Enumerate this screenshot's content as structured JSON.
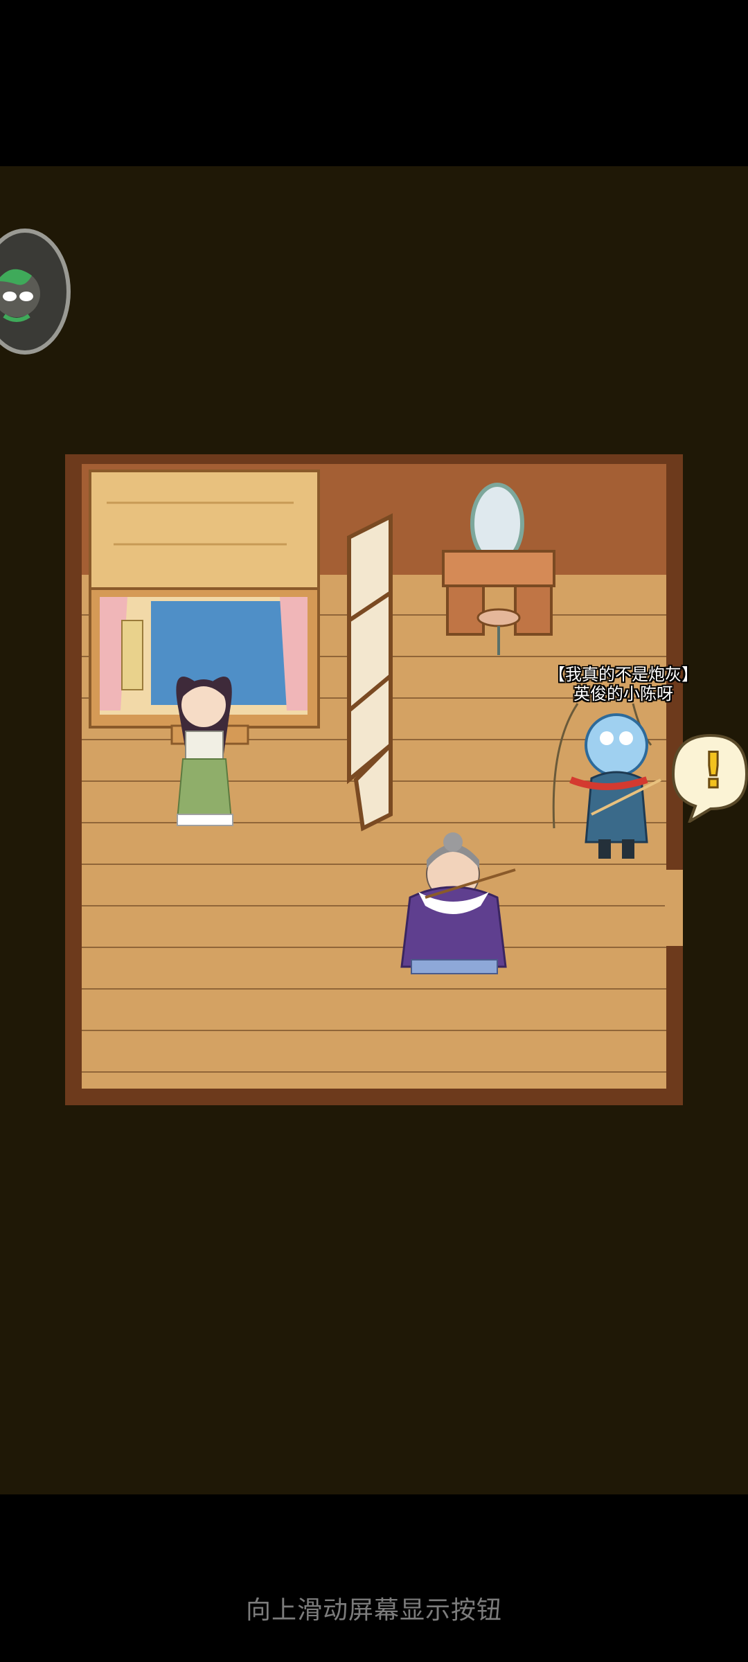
{
  "scene": {
    "npc_title": "【我真的不是炮灰】",
    "npc_name": "英俊的小陈呀",
    "alert_symbol": "!"
  },
  "system": {
    "swipe_hint": "向上滑动屏幕显示按钮"
  },
  "colors": {
    "background": "#1f1806",
    "floor": "#d4a263",
    "wall": "#a45f34",
    "frame": "#6d3a1c",
    "alert": "#f3c21f"
  }
}
